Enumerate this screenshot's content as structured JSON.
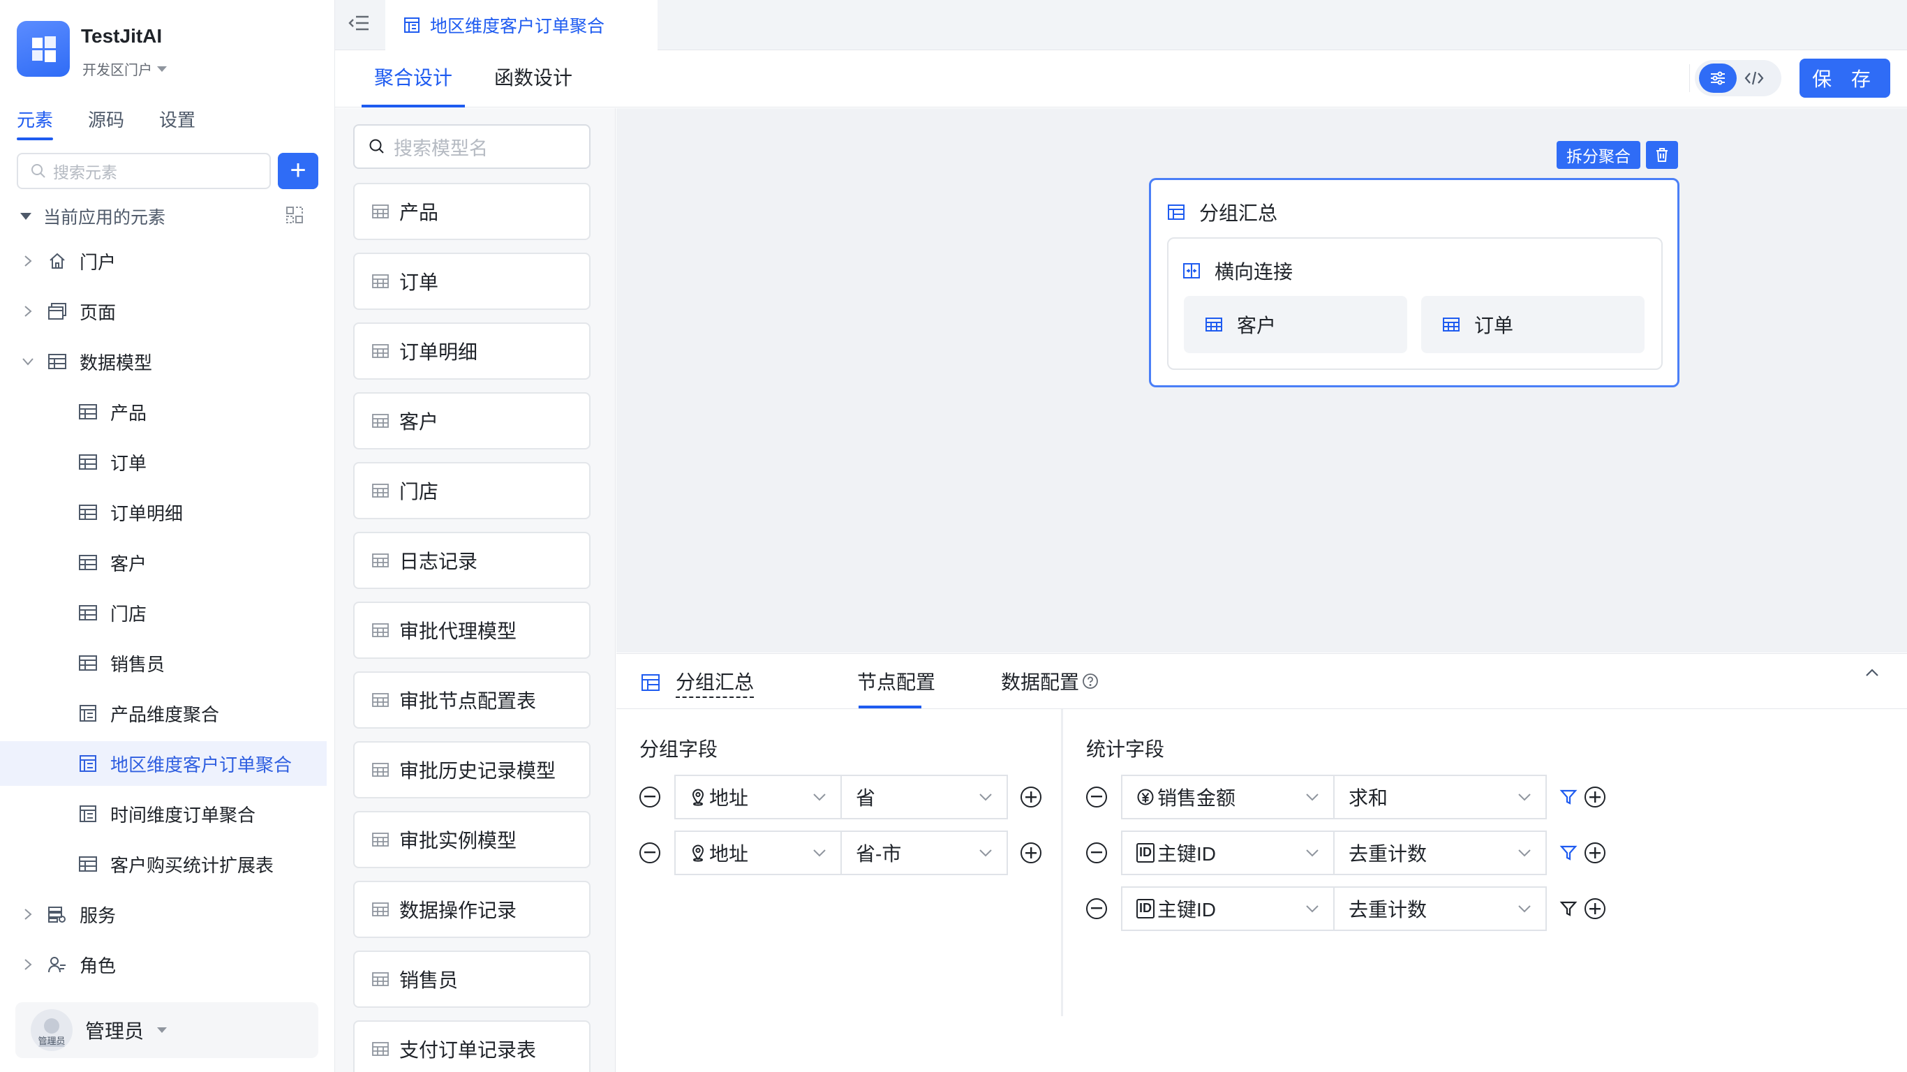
{
  "app": {
    "name": "TestJitAI",
    "portal": "开发区门户"
  },
  "sidebar": {
    "tabs": [
      "元素",
      "源码",
      "设置"
    ],
    "search_placeholder": "搜索元素",
    "add_label": "+",
    "section": "当前应用的元素",
    "tree": [
      {
        "label": "门户",
        "icon": "home-icon"
      },
      {
        "label": "页面",
        "icon": "page-icon"
      },
      {
        "label": "数据模型",
        "icon": "table-icon"
      },
      {
        "label": "产品",
        "icon": "table-icon"
      },
      {
        "label": "订单",
        "icon": "table-icon"
      },
      {
        "label": "订单明细",
        "icon": "table-icon"
      },
      {
        "label": "客户",
        "icon": "table-icon"
      },
      {
        "label": "门店",
        "icon": "table-icon"
      },
      {
        "label": "销售员",
        "icon": "table-icon"
      },
      {
        "label": "产品维度聚合",
        "icon": "aggregate-table-icon"
      },
      {
        "label": "地区维度客户订单聚合",
        "icon": "aggregate-table-icon"
      },
      {
        "label": "时间维度订单聚合",
        "icon": "aggregate-table-icon"
      },
      {
        "label": "客户购买统计扩展表",
        "icon": "table-icon"
      },
      {
        "label": "服务",
        "icon": "service-icon"
      },
      {
        "label": "角色",
        "icon": "role-icon"
      }
    ],
    "user": {
      "name": "管理员",
      "avatar_text": "管理员"
    }
  },
  "topbar": {
    "tab_title": "地区维度客户订单聚合"
  },
  "subtabs": [
    "聚合设计",
    "函数设计"
  ],
  "save_label": "保 存",
  "models": {
    "search_placeholder": "搜索模型名",
    "items": [
      "产品",
      "订单",
      "订单明细",
      "客户",
      "门店",
      "日志记录",
      "审批代理模型",
      "审批节点配置表",
      "审批历史记录模型",
      "审批实例模型",
      "数据操作记录",
      "销售员",
      "支付订单记录表"
    ]
  },
  "canvas": {
    "split_label": "拆分聚合",
    "group_title": "分组汇总",
    "join_title": "横向连接",
    "tables": [
      "客户",
      "订单"
    ]
  },
  "panel": {
    "title": "分组汇总",
    "tabs": [
      "节点配置",
      "数据配置"
    ],
    "group_label": "分组字段",
    "stat_label": "统计字段",
    "group_rows": [
      {
        "field": "地址",
        "level": "省"
      },
      {
        "field": "地址",
        "level": "省-市"
      }
    ],
    "stat_rows": [
      {
        "field": "销售金额",
        "icon": "currency",
        "agg": "求和",
        "filter_active": true
      },
      {
        "field": "主键ID",
        "icon": "id",
        "agg": "去重计数",
        "filter_active": true
      },
      {
        "field": "主键ID",
        "icon": "id",
        "agg": "去重计数",
        "filter_active": false
      }
    ]
  },
  "colors": {
    "accent": "#2f6cf6",
    "text": "#1f2329",
    "canvas_bg": "#f0f2f5"
  }
}
